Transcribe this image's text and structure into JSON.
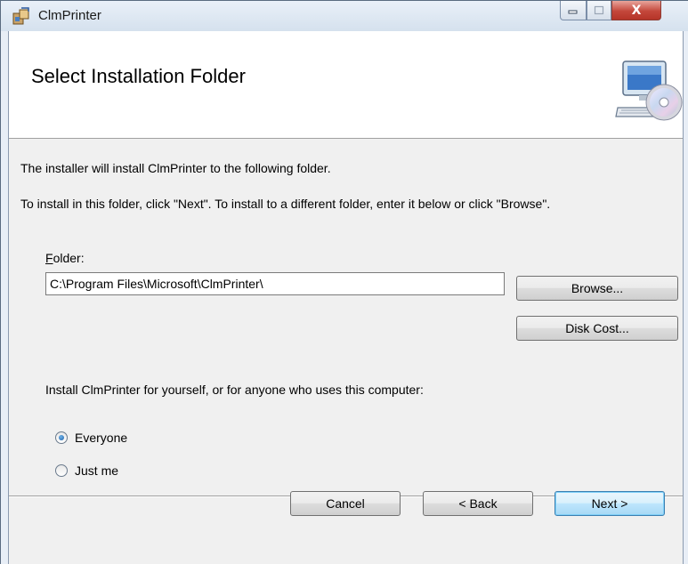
{
  "window": {
    "title": "ClmPrinter",
    "close_glyph": "X",
    "icons": [
      "installer-package-icon",
      "minimize-icon",
      "maximize-icon",
      "close-icon"
    ]
  },
  "banner": {
    "title": "Select Installation Folder",
    "icon": "computer-cd-icon"
  },
  "content": {
    "intro": "The installer will install ClmPrinter to the following folder.",
    "instructions": "To install in this folder, click \"Next\". To install to a different folder, enter it below or click \"Browse\".",
    "folder_label_accel": "F",
    "folder_label_rest": "older:",
    "folder_value": "C:\\Program Files\\Microsoft\\ClmPrinter\\",
    "browse_label": "Browse...",
    "disk_cost_label": "Disk Cost...",
    "install_for_text": "Install ClmPrinter for yourself, or for anyone who uses this computer:",
    "options": [
      {
        "label": "Everyone",
        "selected": true
      },
      {
        "label": "Just me",
        "selected": false
      }
    ]
  },
  "footer": {
    "cancel_label": "Cancel",
    "back_label": "< Back",
    "next_label": "Next >"
  },
  "colors": {
    "accent": "#3c7fb1",
    "close_red": "#c4473b"
  }
}
